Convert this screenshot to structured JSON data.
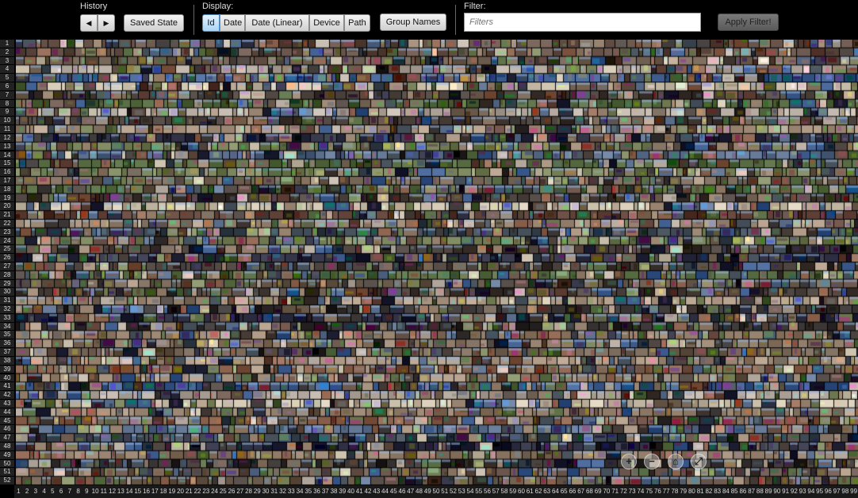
{
  "history": {
    "label": "History",
    "back_icon": "arrow-left",
    "forward_icon": "arrow-right",
    "back_glyph": "◀",
    "forward_glyph": "▶",
    "saved_state_label": "Saved State"
  },
  "display": {
    "label": "Display:",
    "options": [
      "Id",
      "Date",
      "Date (Linear)",
      "Device",
      "Path"
    ],
    "selected": "Id",
    "group_names_label": "Group Names"
  },
  "filter": {
    "label": "Filter:",
    "placeholder": "Filters",
    "value": "",
    "apply_label": "Apply Filter!"
  },
  "grid": {
    "row_labels": [
      "1",
      "2",
      "3",
      "4",
      "5",
      "6",
      "7",
      "8",
      "9",
      "10",
      "11",
      "12",
      "13",
      "14",
      "15",
      "16",
      "17",
      "18",
      "19",
      "20",
      "21",
      "22",
      "23",
      "24",
      "25",
      "26",
      "27",
      "28",
      "29",
      "30",
      "31",
      "32",
      "33",
      "34",
      "35",
      "36",
      "37",
      "38",
      "39",
      "40",
      "41",
      "42",
      "43",
      "44",
      "45",
      "46",
      "47",
      "48",
      "49",
      "50",
      "51",
      "52"
    ],
    "column_labels": [
      "1",
      "2",
      "3",
      "4",
      "5",
      "6",
      "7",
      "8",
      "9",
      "10",
      "11",
      "12",
      "13",
      "14",
      "15",
      "16",
      "17",
      "18",
      "19",
      "20",
      "21",
      "22",
      "23",
      "24",
      "25",
      "26",
      "27",
      "28",
      "29",
      "30",
      "31",
      "32",
      "33",
      "34",
      "35",
      "36",
      "37",
      "38",
      "39",
      "40",
      "41",
      "42",
      "43",
      "44",
      "45",
      "46",
      "47",
      "48",
      "49",
      "50",
      "51",
      "52",
      "53",
      "54",
      "55",
      "56",
      "57",
      "58",
      "59",
      "60",
      "61",
      "62",
      "63",
      "64",
      "65",
      "66",
      "67",
      "68",
      "69",
      "70",
      "71",
      "72",
      "73",
      "74",
      "75",
      "76",
      "77",
      "78",
      "79",
      "80",
      "81",
      "82",
      "83",
      "84",
      "85",
      "86",
      "87",
      "88",
      "89",
      "90",
      "91",
      "92",
      "93",
      "94",
      "95",
      "96",
      "97",
      "98",
      "99"
    ]
  },
  "zoom_controls": {
    "zoom_in_glyph": "+",
    "zoom_out_glyph": "−",
    "home_glyph": "⌂",
    "fullscreen_glyph": "⤢"
  }
}
